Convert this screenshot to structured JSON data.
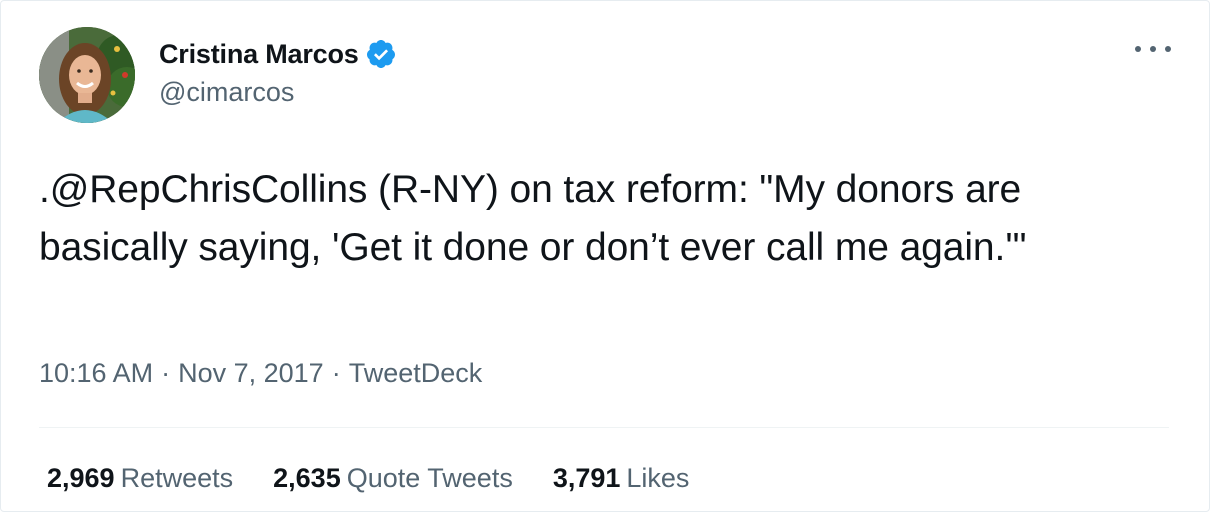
{
  "author": {
    "display_name": "Cristina Marcos",
    "handle": "@cimarcos",
    "verified": true,
    "avatar_icon": "user-avatar-photo"
  },
  "tweet": {
    "text": ".@RepChrisCollins (R-NY) on tax reform: \"My donors are basically saying, 'Get it done or don’t ever call me again.'\"",
    "time": "10:16 AM",
    "date": "Nov 7, 2017",
    "source": "TweetDeck",
    "separator": "·"
  },
  "stats": {
    "retweets": {
      "count": "2,969",
      "label": "Retweets"
    },
    "quotes": {
      "count": "2,635",
      "label": "Quote Tweets"
    },
    "likes": {
      "count": "3,791",
      "label": "Likes"
    }
  },
  "icons": {
    "verified": "verified-badge-icon",
    "more": "more-options-icon"
  },
  "colors": {
    "verified_blue": "#1d9bf0",
    "secondary_text": "#536471",
    "primary_text": "#0f1419"
  }
}
